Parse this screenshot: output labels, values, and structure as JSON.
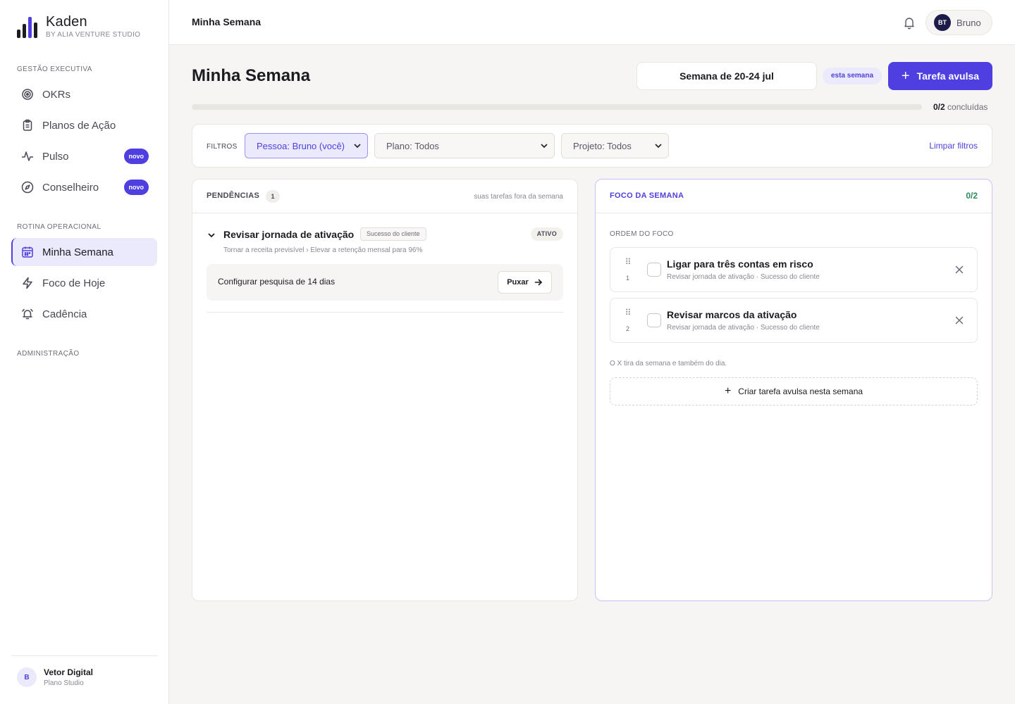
{
  "brand": {
    "name": "Kaden",
    "subtitle": "BY ALIA VENTURE STUDIO"
  },
  "sidebar": {
    "sections": [
      {
        "label": "GESTÃO EXECUTIVA"
      },
      {
        "label": "ROTINA OPERACIONAL"
      },
      {
        "label": "ADMINISTRAÇÃO"
      }
    ],
    "items": [
      {
        "label": "OKRs",
        "icon": "target-icon"
      },
      {
        "label": "Planos de Ação",
        "icon": "clipboard-icon"
      },
      {
        "label": "Pulso",
        "icon": "activity-icon",
        "badge": "novo"
      },
      {
        "label": "Conselheiro",
        "icon": "compass-icon",
        "badge": "novo"
      },
      {
        "label": "Minha Semana",
        "icon": "calendar-icon",
        "active": true
      },
      {
        "label": "Foco de Hoje",
        "icon": "lightning-icon"
      },
      {
        "label": "Cadência",
        "icon": "alarm-icon"
      }
    ],
    "footer": {
      "initial": "B",
      "name": "Vetor Digital",
      "subtitle": "Plano Studio"
    }
  },
  "topbar": {
    "title": "Minha Semana",
    "user": {
      "initials": "BT",
      "name": "Bruno"
    }
  },
  "header": {
    "title": "Minha Semana",
    "week_label": "Semana de 20-24 jul",
    "week_badge": "esta semana",
    "new_task_label": "Tarefa avulsa",
    "progress": {
      "done": "0/2",
      "suffix": "concluídas",
      "fraction": 0
    }
  },
  "filters": {
    "label": "FILTROS",
    "person": "Pessoa: Bruno (você)",
    "plan": "Plano: Todos",
    "project": "Projeto: Todos",
    "clear_label": "Limpar filtros"
  },
  "pending": {
    "title": "PENDÊNCIAS",
    "count": "1",
    "hint": "suas tarefas fora da semana",
    "group": {
      "title": "Revisar jornada de ativação",
      "tag": "Sucesso do cliente",
      "status": "ATIVO",
      "path": "Tornar a receita previsível › Elevar a retenção mensal para 96%",
      "task": "Configurar pesquisa de 14 dias",
      "pull_label": "Puxar"
    }
  },
  "focus": {
    "title": "FOCO DA SEMANA",
    "count": "0/2",
    "order_label": "ORDEM DO FOCO",
    "items": [
      {
        "num": "1",
        "title": "Ligar para três contas em risco",
        "subtitle": "Revisar jornada de ativação · Sucesso do cliente"
      },
      {
        "num": "2",
        "title": "Revisar marcos da ativação",
        "subtitle": "Revisar jornada de ativação · Sucesso do cliente"
      }
    ],
    "note": "O X tira da semana e também do dia.",
    "create_label": "Criar tarefa avulsa nesta semana"
  },
  "colors": {
    "accent": "#4f3fe0",
    "accent_soft": "#ebe9fc",
    "success": "#2d8a5e"
  }
}
